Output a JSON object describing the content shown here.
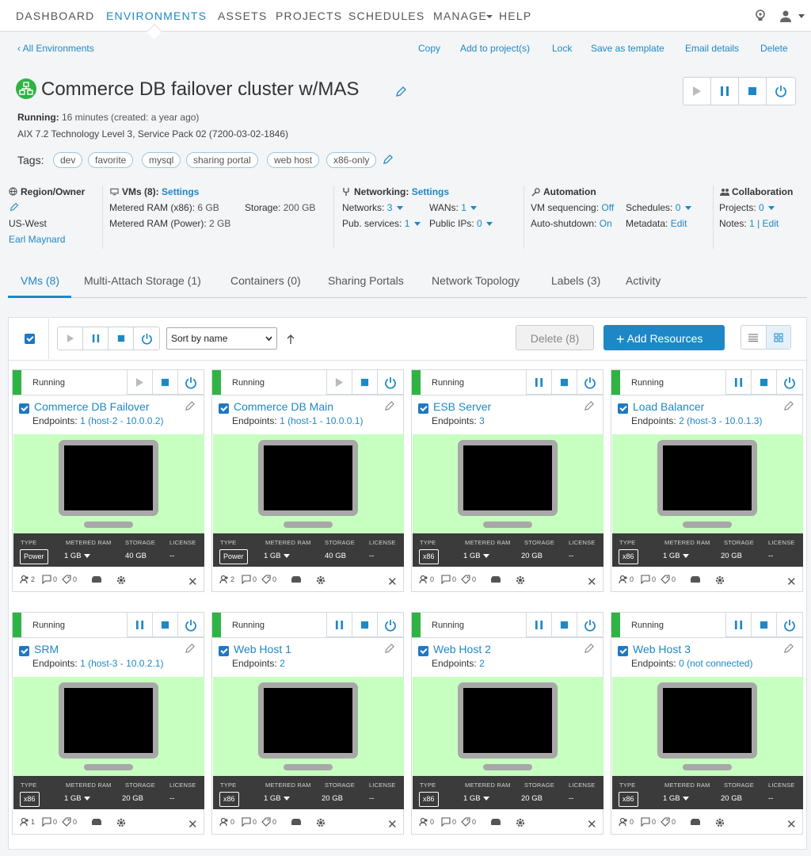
{
  "nav": {
    "items": [
      "DASHBOARD",
      "ENVIRONMENTS",
      "ASSETS",
      "PROJECTS",
      "SCHEDULES",
      "MANAGE",
      "HELP"
    ],
    "active": "ENVIRONMENTS"
  },
  "breadcrumb": {
    "back_label": "All Environments"
  },
  "actions": [
    "Copy",
    "Add to project(s)",
    "Lock",
    "Save as template",
    "Email details",
    "Delete"
  ],
  "env": {
    "title": "Commerce DB failover cluster w/MAS",
    "status_label": "Running:",
    "status_text": "16 minutes (created: a year ago)",
    "os": "AIX 7.2 Technology Level 3, Service Pack 02 (7200-03-02-1846)"
  },
  "tags": {
    "label": "Tags:",
    "items": [
      "dev",
      "favorite",
      "mysql",
      "sharing portal",
      "web host",
      "x86-only"
    ]
  },
  "info": {
    "region": {
      "heading": "Region/Owner",
      "region": "US-West",
      "owner": "Earl Maynard"
    },
    "vms": {
      "heading": "VMs (8):",
      "settings": "Settings",
      "ram_x86_label": "Metered RAM (x86):",
      "ram_x86": "6 GB",
      "storage_label": "Storage:",
      "storage": "200 GB",
      "ram_power_label": "Metered RAM (Power):",
      "ram_power": "2 GB"
    },
    "networking": {
      "heading": "Networking:",
      "settings": "Settings",
      "networks_label": "Networks:",
      "networks": "3",
      "wans_label": "WANs:",
      "wans": "1",
      "pub_label": "Pub. services:",
      "pub": "1",
      "ips_label": "Public IPs:",
      "ips": "0"
    },
    "automation": {
      "heading": "Automation",
      "seq_label": "VM sequencing:",
      "seq": "Off",
      "sched_label": "Schedules:",
      "sched": "0",
      "shutdown_label": "Auto-shutdown:",
      "shutdown": "On",
      "meta_label": "Metadata:",
      "meta": "Edit"
    },
    "collab": {
      "heading": "Collaboration",
      "projects_label": "Projects:",
      "projects": "0",
      "notes_label": "Notes:",
      "notes": "1",
      "notes_edit": "Edit"
    }
  },
  "tabs": [
    "VMs (8)",
    "Multi-Attach Storage (1)",
    "Containers (0)",
    "Sharing Portals",
    "Network Topology",
    "Labels (3)",
    "Activity"
  ],
  "toolbar": {
    "sort": "Sort by name",
    "delete": "Delete (8)",
    "add": "Add Resources"
  },
  "spec_labels": {
    "type": "TYPE",
    "ram": "METERED RAM",
    "storage": "STORAGE",
    "license": "LICENSE"
  },
  "vms": [
    {
      "status": "Running",
      "name": "Commerce DB Failover",
      "endpoints_label": "Endpoints:",
      "endpoints": "1 (host-2 - 10.0.0.2)",
      "type": "Power",
      "ram": "1 GB",
      "storage": "40 GB",
      "license": "--",
      "f1": "2",
      "f2": "0",
      "f3": "0"
    },
    {
      "status": "Running",
      "name": "Commerce DB Main",
      "endpoints_label": "Endpoints:",
      "endpoints": "1 (host-1 - 10.0.0.1)",
      "type": "Power",
      "ram": "1 GB",
      "storage": "40 GB",
      "license": "--",
      "f1": "2",
      "f2": "0",
      "f3": "0"
    },
    {
      "status": "Running",
      "name": "ESB Server",
      "endpoints_label": "Endpoints:",
      "endpoints": "3",
      "type": "x86",
      "ram": "1 GB",
      "storage": "20 GB",
      "license": "--",
      "f1": "0",
      "f2": "0",
      "f3": "0"
    },
    {
      "status": "Running",
      "name": "Load Balancer",
      "endpoints_label": "Endpoints:",
      "endpoints": "2 (host-3 - 10.0.1.3)",
      "type": "x86",
      "ram": "1 GB",
      "storage": "20 GB",
      "license": "--",
      "f1": "0",
      "f2": "0",
      "f3": "0"
    },
    {
      "status": "Running",
      "name": "SRM",
      "endpoints_label": "Endpoints:",
      "endpoints": "1 (host-3 - 10.0.2.1)",
      "type": "x86",
      "ram": "1 GB",
      "storage": "20 GB",
      "license": "--",
      "f1": "1",
      "f2": "0",
      "f3": "0"
    },
    {
      "status": "Running",
      "name": "Web Host 1",
      "endpoints_label": "Endpoints:",
      "endpoints": "2",
      "type": "x86",
      "ram": "1 GB",
      "storage": "20 GB",
      "license": "--",
      "f1": "0",
      "f2": "0",
      "f3": "0"
    },
    {
      "status": "Running",
      "name": "Web Host 2",
      "endpoints_label": "Endpoints:",
      "endpoints": "2",
      "type": "x86",
      "ram": "1 GB",
      "storage": "20 GB",
      "license": "--",
      "f1": "0",
      "f2": "0",
      "f3": "0"
    },
    {
      "status": "Running",
      "name": "Web Host 3",
      "endpoints_label": "Endpoints:",
      "endpoints": "0 (not connected)",
      "type": "x86",
      "ram": "1 GB",
      "storage": "20 GB",
      "license": "--",
      "f1": "0",
      "f2": "0",
      "f3": "0"
    }
  ]
}
